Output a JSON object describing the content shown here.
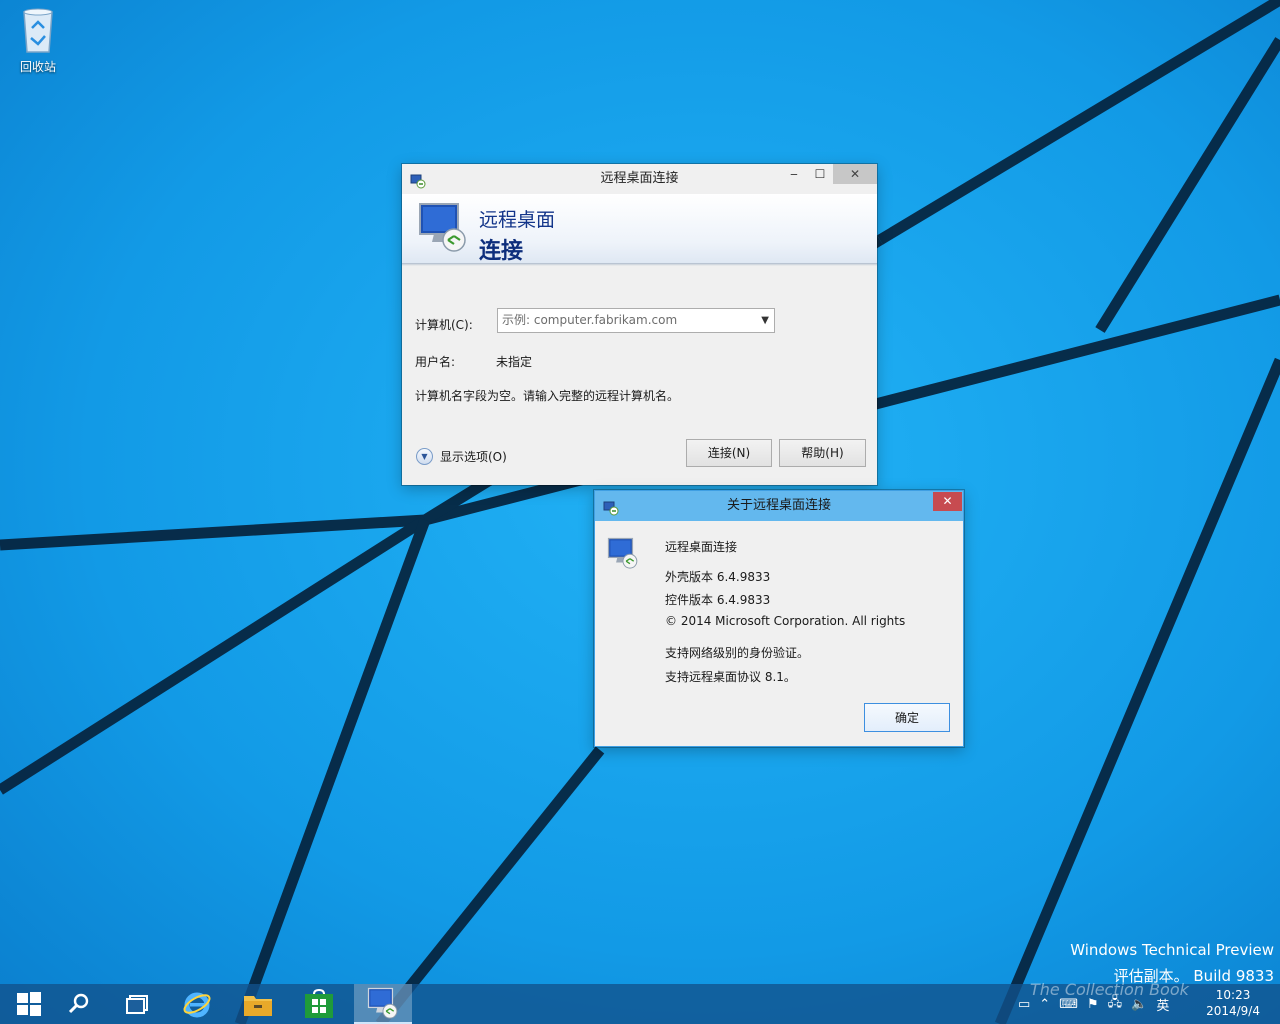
{
  "desktop": {
    "recycle_bin_label": "回收站",
    "watermark_line1": "Windows Technical Preview",
    "watermark_line2": "评估副本。 Build 9833"
  },
  "main_window": {
    "title": "远程桌面连接",
    "banner_line1": "远程桌面",
    "banner_line2": "连接",
    "computer_label": "计算机(C):",
    "computer_placeholder": "示例: computer.fabrikam.com",
    "user_label": "用户名:",
    "user_value": "未指定",
    "message": "计算机名字段为空。请输入完整的远程计算机名。",
    "show_options": "显示选项(O)",
    "connect_button": "连接(N)",
    "help_button": "帮助(H)"
  },
  "about_dialog": {
    "title": "关于远程桌面连接",
    "app_name": "远程桌面连接",
    "shell_version": "外壳版本 6.4.9833",
    "control_version": "控件版本 6.4.9833",
    "copyright": "© 2014 Microsoft Corporation. All rights",
    "nla": "支持网络级别的身份验证。",
    "protocol": "支持远程桌面协议 8.1。",
    "ok_button": "确定"
  },
  "taskbar": {
    "input_language": "英",
    "time": "10:23",
    "date": "2014/9/4",
    "overlay_text": "The Collection Book"
  },
  "colors": {
    "wallpaper": "#1aa3ee",
    "about_titlebar": "#63b8ee",
    "close_red": "#c74b50",
    "banner_text": "#13358a"
  }
}
